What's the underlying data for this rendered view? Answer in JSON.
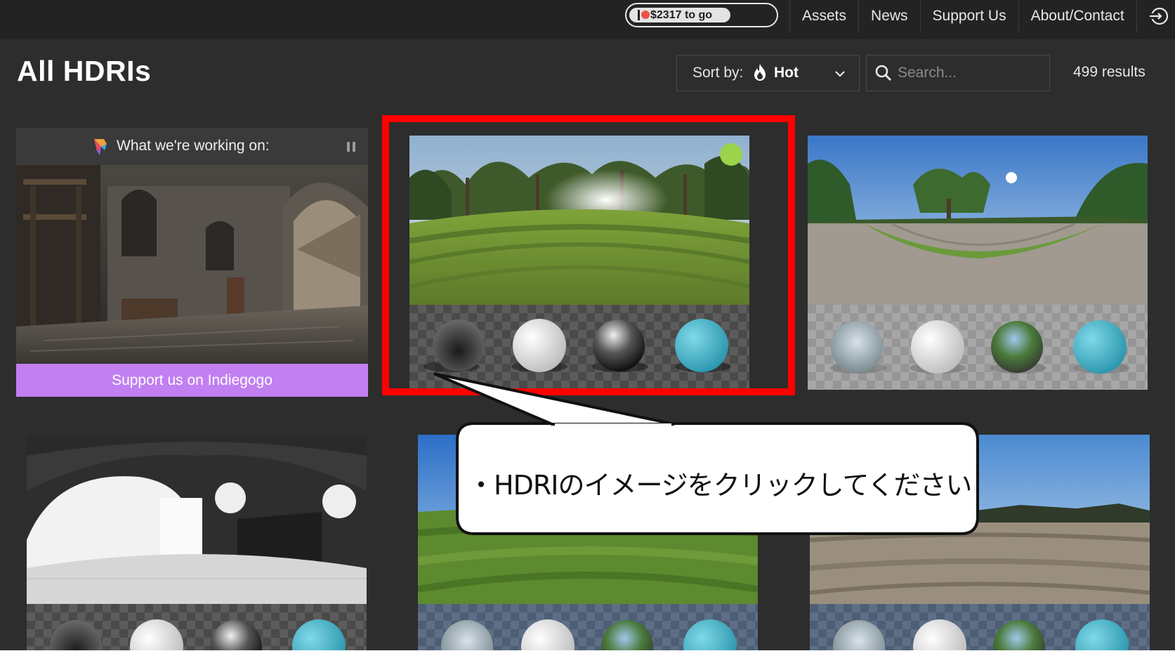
{
  "nav": {
    "funding_label": "$2317 to go",
    "links": [
      "Assets",
      "News",
      "Support Us",
      "About/Contact"
    ],
    "login_icon": "login-icon"
  },
  "header": {
    "title": "All HDRIs",
    "sort_label": "Sort by:",
    "sort_value": "Hot",
    "search_placeholder": "Search...",
    "results": "499 results"
  },
  "working_on": {
    "label": "What we're working on:",
    "button": "Support us on Indiegogo"
  },
  "callout": {
    "text": "・HDRIのイメージをクリックしてください"
  },
  "colors": {
    "accent_purple": "#c17ff2",
    "highlight_red": "#ff0000",
    "new_badge": "#9bd34a"
  }
}
